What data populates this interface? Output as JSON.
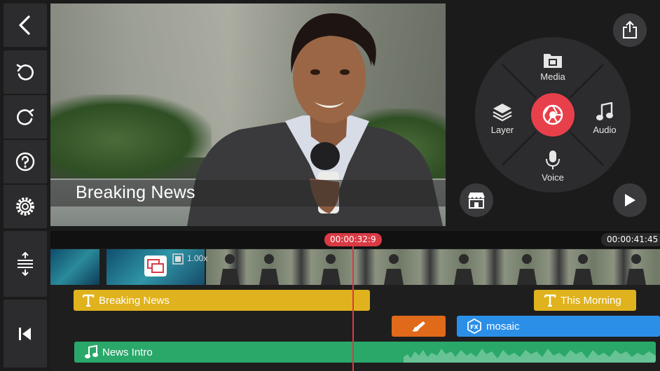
{
  "preview": {
    "caption": "Breaking News"
  },
  "menu": {
    "media_label": "Media",
    "audio_label": "Audio",
    "voice_label": "Voice",
    "layer_label": "Layer"
  },
  "timeline": {
    "current_time": "00:00:32:9",
    "total_time": "00:00:41:45",
    "clip_speed": "1.00x",
    "tracks": {
      "text1": "Breaking News",
      "text2": "This Morning",
      "effect": "mosaic",
      "audio": "News Intro"
    }
  },
  "colors": {
    "record": "#e8404b",
    "text_track": "#e0b21d",
    "handwriting_track": "#e0691a",
    "effect_track": "#2b8fe8",
    "audio_track": "#2aa86a",
    "playhead": "#d93a44"
  },
  "icons": [
    "back-icon",
    "undo-icon",
    "redo-icon",
    "help-icon",
    "settings-icon",
    "share-icon",
    "media-icon",
    "audio-icon",
    "voice-icon",
    "layer-icon",
    "record-icon",
    "asset-store-icon",
    "play-icon",
    "track-height-icon",
    "go-to-start-icon"
  ]
}
